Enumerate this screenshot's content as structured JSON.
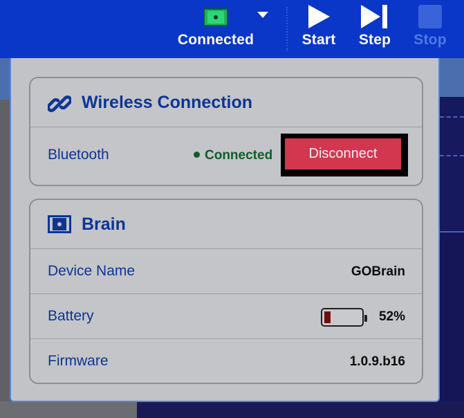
{
  "toolbar": {
    "connection_label": "Connected",
    "start_label": "Start",
    "step_label": "Step",
    "stop_label": "Stop",
    "icons": {
      "connection": "brain-connected-icon",
      "dropdown": "chevron-down-icon",
      "start": "play-icon",
      "step": "step-icon",
      "stop": "stop-icon"
    }
  },
  "wireless": {
    "title": "Wireless Connection",
    "icon": "link-icon",
    "bluetooth_label": "Bluetooth",
    "status": "Connected",
    "disconnect_label": "Disconnect"
  },
  "brain": {
    "title": "Brain",
    "icon": "brain-icon",
    "device_name_label": "Device Name",
    "device_name": "GOBrain",
    "battery_label": "Battery",
    "battery_level": 0.52,
    "battery_text": "52%",
    "firmware_label": "Firmware",
    "firmware": "1.0.9.b16"
  },
  "colors": {
    "toolbar_bg": "#0a37c8",
    "accent_text": "#0d3593",
    "connected_green": "#0f5e2a",
    "disconnect_red": "#d2374f",
    "battery_low": "#6f0e0d"
  }
}
